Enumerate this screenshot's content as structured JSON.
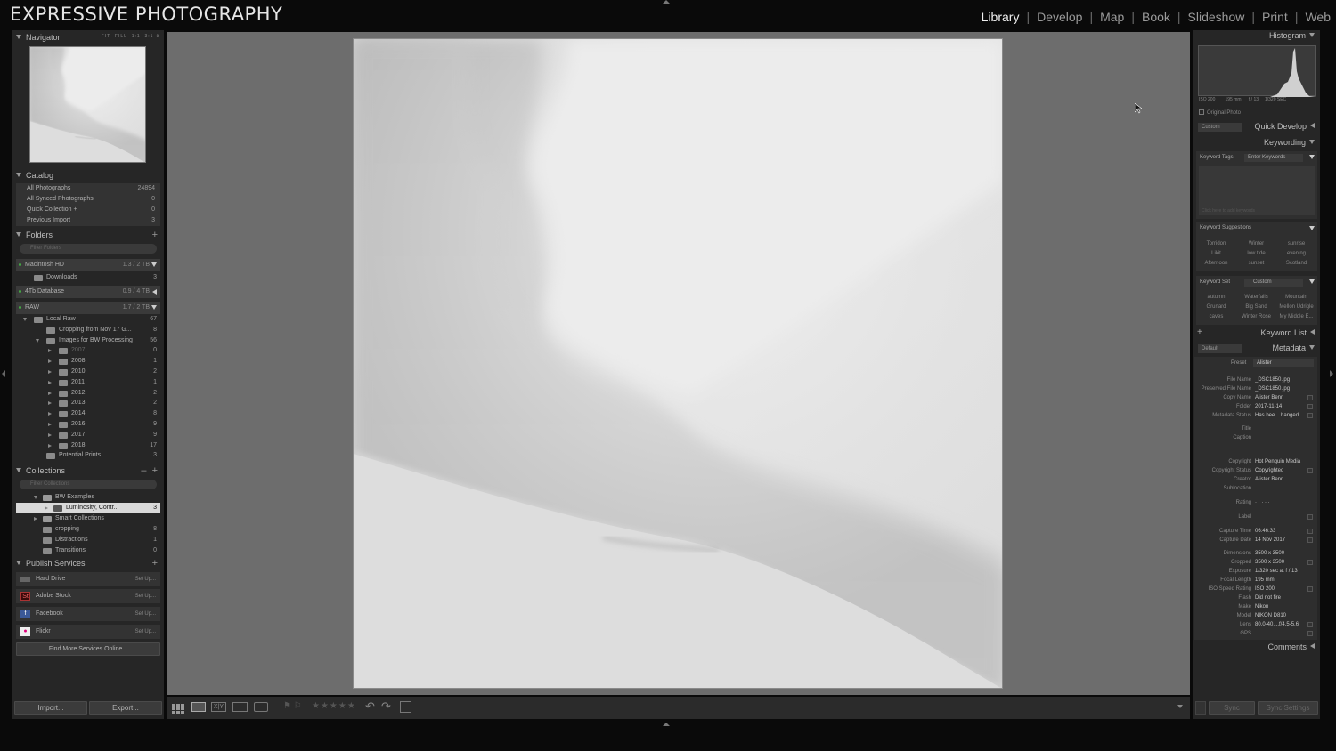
{
  "app": {
    "brand": "EXPRESSIVE PHOTOGRAPHY"
  },
  "modules": [
    {
      "label": "Library",
      "active": true
    },
    {
      "label": "Develop"
    },
    {
      "label": "Map"
    },
    {
      "label": "Book"
    },
    {
      "label": "Slideshow"
    },
    {
      "label": "Print"
    },
    {
      "label": "Web"
    }
  ],
  "navigator": {
    "title": "Navigator",
    "zoom": [
      "FIT",
      "FILL",
      "1:1",
      "3:1"
    ]
  },
  "catalog": {
    "title": "Catalog",
    "items": [
      {
        "label": "All Photographs",
        "count": "24894"
      },
      {
        "label": "All Synced Photographs",
        "count": "0"
      },
      {
        "label": "Quick Collection +",
        "count": "0"
      },
      {
        "label": "Previous Import",
        "count": "3"
      }
    ]
  },
  "folders": {
    "title": "Folders",
    "filter_placeholder": "Filter Folders",
    "volumes": [
      {
        "label": "Macintosh HD",
        "size": "1.3 / 2 TB"
      },
      {
        "label": "4Tb Database",
        "size": "0.9 / 4 TB"
      },
      {
        "label": "RAW",
        "size": "1.7 / 2 TB"
      }
    ],
    "mac_items": [
      {
        "label": "Downloads",
        "count": "3"
      }
    ],
    "raw_items": [
      {
        "label": "Local Raw",
        "count": "67"
      },
      {
        "label": "Cropping from Nov 17 G...",
        "count": "8"
      },
      {
        "label": "Images for BW Processing",
        "count": "56"
      },
      {
        "label": "2007",
        "count": "0"
      },
      {
        "label": "2008",
        "count": "1"
      },
      {
        "label": "2010",
        "count": "2"
      },
      {
        "label": "2011",
        "count": "1"
      },
      {
        "label": "2012",
        "count": "2"
      },
      {
        "label": "2013",
        "count": "2"
      },
      {
        "label": "2014",
        "count": "8"
      },
      {
        "label": "2016",
        "count": "9"
      },
      {
        "label": "2017",
        "count": "9"
      },
      {
        "label": "2018",
        "count": "17"
      },
      {
        "label": "Potential Prints",
        "count": "3"
      }
    ]
  },
  "collections": {
    "title": "Collections",
    "filter_placeholder": "Filter Collections",
    "items": [
      {
        "label": "BW Examples",
        "count": ""
      },
      {
        "label": "Luminosity, Contr...",
        "count": "3"
      },
      {
        "label": "Smart Collections",
        "count": ""
      },
      {
        "label": "cropping",
        "count": "8"
      },
      {
        "label": "Distractions",
        "count": "1"
      },
      {
        "label": "Transitions",
        "count": "0"
      }
    ]
  },
  "publish": {
    "title": "Publish Services",
    "items": [
      {
        "label": "Hard Drive",
        "action": "Set Up..."
      },
      {
        "label": "Adobe Stock",
        "action": "Set Up..."
      },
      {
        "label": "Facebook",
        "action": "Set Up..."
      },
      {
        "label": "Flickr",
        "action": "Set Up..."
      }
    ],
    "find_more": "Find More Services Online..."
  },
  "left_buttons": {
    "import": "Import...",
    "export": "Export..."
  },
  "histogram": {
    "title": "Histogram",
    "iso": "ISO 200",
    "focal": "195 mm",
    "aperture": "f / 13",
    "shutter": "1/320 SEC",
    "original_photo": "Original Photo"
  },
  "quick_develop": {
    "preset": "Custom",
    "title": "Quick Develop"
  },
  "keywording": {
    "title": "Keywording",
    "tags_label": "Keyword Tags",
    "tags_value": "Enter Keywords",
    "click_hint": "Click here to add keywords",
    "suggestions_title": "Keyword Suggestions",
    "suggestions": [
      "Torridon",
      "Winter",
      "sunrise",
      "Likit",
      "low tide",
      "evening",
      "Afternoon",
      "sunset",
      "Scotland"
    ],
    "set_label": "Keyword Set",
    "set_value": "Custom",
    "set_items": [
      "autumn",
      "Waterfalls",
      "Mountain",
      "Grunard",
      "Big Sand",
      "Mellon Udrigle",
      "caves",
      "Winter Rose",
      "My Middle E..."
    ]
  },
  "keyword_list": {
    "title": "Keyword List"
  },
  "metadata": {
    "title": "Metadata",
    "view": "Default",
    "preset_label": "Preset",
    "preset_value": "Alister",
    "fields": [
      {
        "label": "File Name",
        "value": "_DSC1850.jpg"
      },
      {
        "label": "Preserved File Name",
        "value": "_DSC1850.jpg"
      },
      {
        "label": "Copy Name",
        "value": "Alister Benn"
      },
      {
        "label": "Folder",
        "value": "2017-11-14"
      },
      {
        "label": "Metadata Status",
        "value": "Has bee....hanged"
      },
      {
        "label": "Title",
        "value": ""
      },
      {
        "label": "Caption",
        "value": ""
      },
      {
        "label": "Copyright",
        "value": "Hot Penguin Media"
      },
      {
        "label": "Copyright Status",
        "value": "Copyrighted"
      },
      {
        "label": "Creator",
        "value": "Alister Benn"
      },
      {
        "label": "Sublocation",
        "value": ""
      },
      {
        "label": "Rating",
        "value": "· · · · ·"
      },
      {
        "label": "Label",
        "value": ""
      },
      {
        "label": "Capture Time",
        "value": "06:46:33"
      },
      {
        "label": "Capture Date",
        "value": "14 Nov 2017"
      },
      {
        "label": "Dimensions",
        "value": "3500 x 3500"
      },
      {
        "label": "Cropped",
        "value": "3500 x 3500"
      },
      {
        "label": "Exposure",
        "value": "1/320 sec at f / 13"
      },
      {
        "label": "Focal Length",
        "value": "195 mm"
      },
      {
        "label": "ISO Speed Rating",
        "value": "ISO 200"
      },
      {
        "label": "Flash",
        "value": "Did not fire"
      },
      {
        "label": "Make",
        "value": "Nikon"
      },
      {
        "label": "Model",
        "value": "NIKON D810"
      },
      {
        "label": "Lens",
        "value": "80.0-40....f/4.5-5.6"
      },
      {
        "label": "GPS",
        "value": ""
      }
    ]
  },
  "comments": {
    "title": "Comments"
  },
  "right_buttons": {
    "sync": "Sync",
    "sync_settings": "Sync Settings"
  }
}
